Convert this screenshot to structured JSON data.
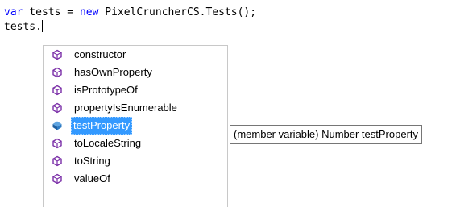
{
  "editor": {
    "line1": {
      "keyword_var": "var",
      "text1": " tests = ",
      "keyword_new": "new",
      "text2": " PixelCruncherCS.Tests();"
    },
    "line2": "tests."
  },
  "completion": {
    "items": [
      {
        "label": "constructor",
        "icon": "method-icon"
      },
      {
        "label": "hasOwnProperty",
        "icon": "method-icon"
      },
      {
        "label": "isPrototypeOf",
        "icon": "method-icon"
      },
      {
        "label": "propertyIsEnumerable",
        "icon": "method-icon"
      },
      {
        "label": "testProperty",
        "icon": "field-icon",
        "selected": true
      },
      {
        "label": "toLocaleString",
        "icon": "method-icon"
      },
      {
        "label": "toString",
        "icon": "method-icon"
      },
      {
        "label": "valueOf",
        "icon": "method-icon"
      }
    ],
    "tooltip": "(member variable) Number testProperty"
  },
  "colors": {
    "keyword": "#0000ff",
    "method_icon": "#7b2fa8",
    "field_icon": "#1e5fa0",
    "selection": "#3399ff"
  }
}
